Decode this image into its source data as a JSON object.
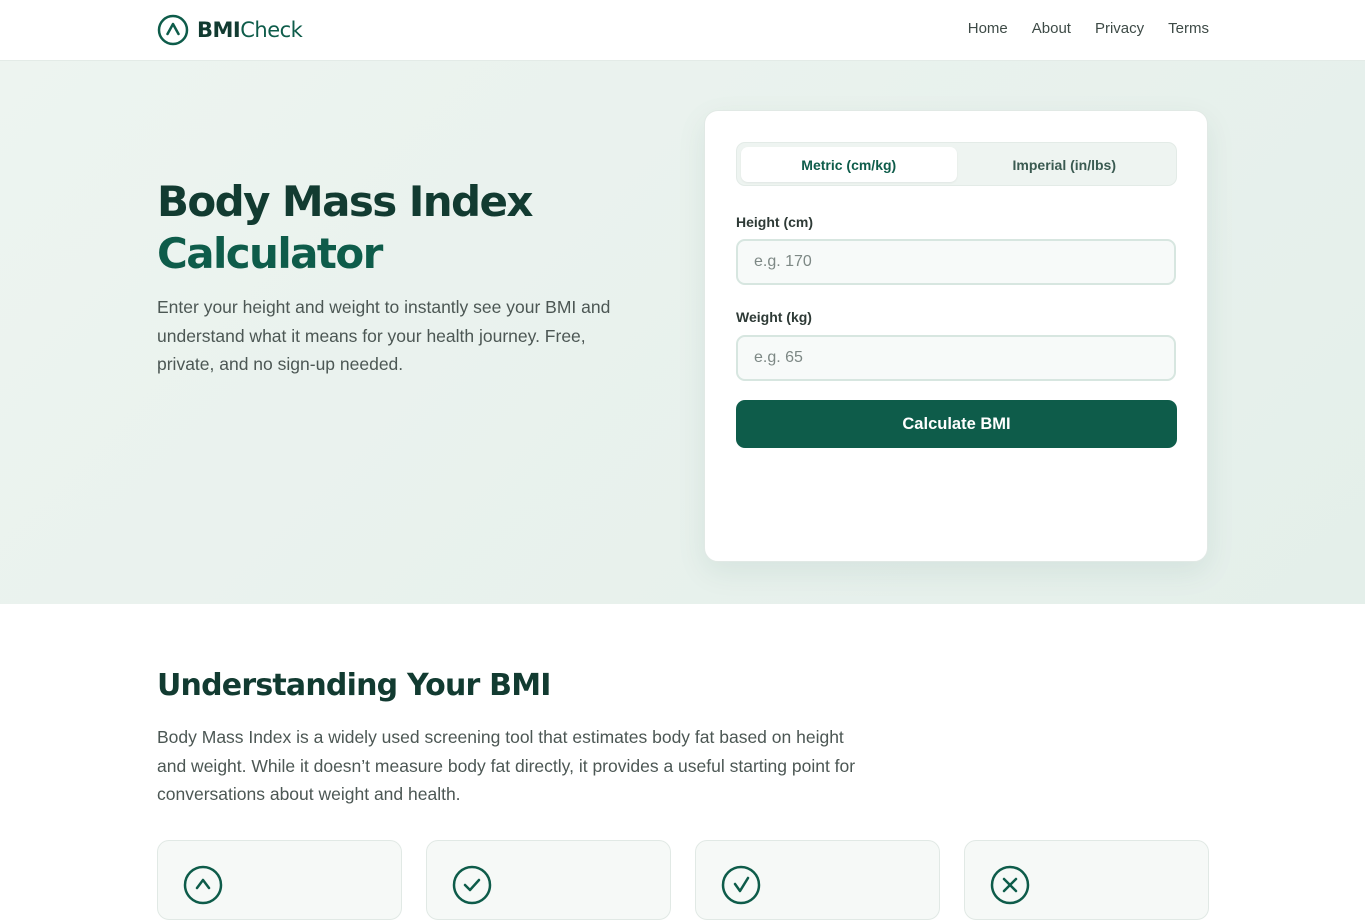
{
  "header": {
    "logo_strong": "BMI",
    "logo_rest": "Check",
    "nav": [
      "Home",
      "About",
      "Privacy",
      "Terms"
    ]
  },
  "hero": {
    "title_line1": "Body Mass Index",
    "title_line2": "Calculator",
    "description": "Enter your height and weight to instantly see your BMI and understand what it means for your health journey. Free, private, and no sign-up needed."
  },
  "calculator": {
    "tabs": [
      {
        "label": "Metric (cm/kg)",
        "active": true
      },
      {
        "label": "Imperial (in/lbs)",
        "active": false
      }
    ],
    "height_label": "Height (cm)",
    "height_value": "",
    "height_placeholder": "e.g. 170",
    "weight_label": "Weight (kg)",
    "weight_value": "",
    "weight_placeholder": "e.g. 65",
    "button_label": "Calculate BMI"
  },
  "understanding": {
    "title": "Understanding Your BMI",
    "description": "Body Mass Index is a widely used screening tool that estimates body fat based on height and weight. While it doesn’t measure body fat directly, it provides a useful starting point for conversations about weight and health.",
    "cards": [
      {
        "icon": "chevron-up-icon"
      },
      {
        "icon": "check-icon"
      },
      {
        "icon": "check-icon"
      },
      {
        "icon": "x-icon"
      }
    ]
  },
  "colors": {
    "brand": "#0e5c4a",
    "brand_dark": "#123b31",
    "hero_bg": "#edf4f0"
  }
}
